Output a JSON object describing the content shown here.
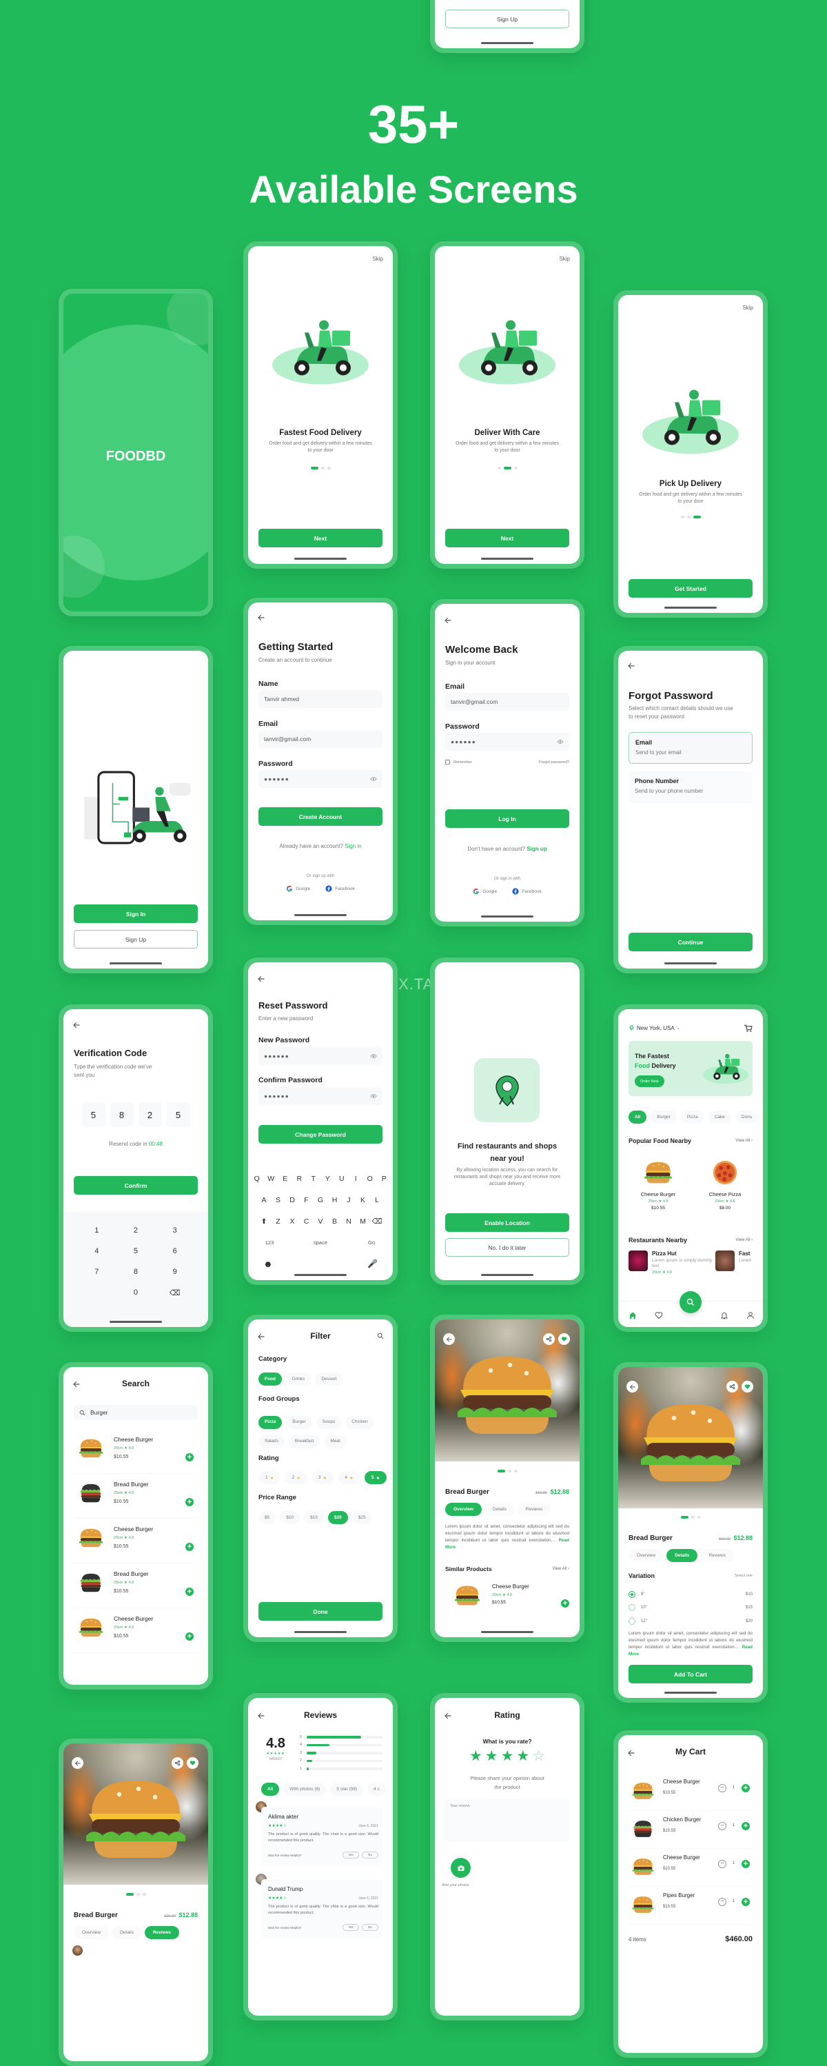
{
  "colors": {
    "background": "#21ba5b",
    "frame": "#4dc87b",
    "accent": "#22b85b",
    "light_accent": "#d4f2df",
    "star_rating": "#f4b740"
  },
  "hero": {
    "count": "35+",
    "title": "Available Screens"
  },
  "watermark": "早道大咖  IAMDX.TAOBAO.COM",
  "top_partial": {
    "sign_up": "Sign Up"
  },
  "splash": {
    "brand": "FOODBD"
  },
  "onboard1": {
    "skip": "Skip",
    "title": "Fastest Food Delivery",
    "desc": "Order food and get delivery within a few minutes to your door",
    "button": "Next",
    "active_page": 1,
    "pages": 3
  },
  "onboard2": {
    "skip": "Skip",
    "title": "Deliver With Care",
    "desc": "Order food and get delivery within a few minutes to your door",
    "button": "Next",
    "active_page": 2,
    "pages": 3
  },
  "onboard3": {
    "skip": "Skip",
    "title": "Pick Up Delivery",
    "desc": "Order food and get delivery within a few minutes to your door",
    "button": "Get Started",
    "active_page": 3,
    "pages": 3
  },
  "signin_landing": {
    "sign_in": "Sign In",
    "sign_up": "Sign Up"
  },
  "getting_started": {
    "title": "Getting Started",
    "subtitle": "Create an account to continue",
    "name_label": "Name",
    "name_value": "Tanvir ahmed",
    "email_label": "Email",
    "email_value": "tanvir@gmail.com",
    "password_label": "Password",
    "password_value": "●●●●●●",
    "button": "Create Account",
    "have_account": "Already have an account? ",
    "sign_in_link": "Sign in",
    "or": "Or sign up with",
    "google": "Google",
    "facebook": "Facebook"
  },
  "welcome_back": {
    "title": "Welcome Back",
    "subtitle": "Sign in your account",
    "email_label": "Email",
    "email_value": "tanvir@gmail.com",
    "password_label": "Password",
    "password_value": "●●●●●●",
    "remember": "Remember",
    "forgot": "Forgot password?",
    "remember_checked": false,
    "button": "Log In",
    "no_account": "Don't have an account? ",
    "sign_up_link": "Sign up",
    "or": "Or sign in with",
    "google": "Google",
    "facebook": "Facebook"
  },
  "forgot": {
    "title": "Forgot Password",
    "subtitle": "Select which contact details should we use to reset your password",
    "options": [
      {
        "title": "Email",
        "desc": "Send to your email",
        "selected": true
      },
      {
        "title": "Phone Number",
        "desc": "Send to your phone number",
        "selected": false
      }
    ],
    "button": "Continue"
  },
  "reset": {
    "title": "Reset Password",
    "subtitle": "Enter a new password",
    "new_label": "New Password",
    "new_value": "●●●●●●",
    "confirm_label": "Confirm Password",
    "confirm_value": "●●●●●●",
    "button": "Change Password",
    "keyboard": [
      [
        "Q",
        "W",
        "E",
        "R",
        "T",
        "Y",
        "U",
        "I",
        "O",
        "P"
      ],
      [
        "A",
        "S",
        "D",
        "F",
        "G",
        "H",
        "J",
        "K",
        "L"
      ],
      [
        "⬆",
        "Z",
        "X",
        "C",
        "V",
        "B",
        "N",
        "M",
        "⌫"
      ],
      [
        "123",
        "space",
        "Go"
      ]
    ]
  },
  "location": {
    "title": "Find restaurants and shops near you!",
    "desc": "By allowing location access, you can search for restaurants and shops near you and receive more accuate delivery.",
    "enable": "Enable Location",
    "later": "No. I do it later"
  },
  "verify": {
    "title": "Verification Code",
    "subtitle": "Type the verification code we've sent you",
    "code": [
      "5",
      "8",
      "2",
      "5"
    ],
    "resend": "Resend code in ",
    "timer": "00:48",
    "button": "Confirm",
    "keypad": [
      "1",
      "2",
      "3",
      "4",
      "5",
      "6",
      "7",
      "8",
      "9",
      "",
      "0",
      "⌫"
    ]
  },
  "home": {
    "location": "New York, USA",
    "banner_line1": "The Fastest",
    "banner_green": "Food",
    "banner_rest": " Delivery",
    "order_now": "Order Now",
    "chips": [
      "All",
      "Burger",
      "Pizza",
      "Cake",
      "Donu"
    ],
    "active_chip": 0,
    "popular": "Popular Food Nearby",
    "view_all": "View All",
    "foods": [
      {
        "name": "Cheese Burger",
        "dist": "25km",
        "rating": "4.8",
        "price": "$10.55"
      },
      {
        "name": "Cheese Pizza",
        "dist": "25km",
        "rating": "4.8",
        "price": "$8.00"
      }
    ],
    "restaurants_title": "Restaurants Nearby",
    "restaurants": [
      {
        "name": "Pizza Hut",
        "desc": "Lorem ipsum is simply dummy text",
        "dist": "25km",
        "rating": "4.8"
      },
      {
        "name": "Fast",
        "desc": "Lorem",
        "dist": "25km",
        "rating": ""
      }
    ]
  },
  "search": {
    "title": "Search",
    "query": "Burger",
    "results": [
      {
        "name": "Cheese Burger",
        "dist": "25km",
        "rating": "4.8",
        "price": "$10.55",
        "dark": false
      },
      {
        "name": "Bread Burger",
        "dist": "25km",
        "rating": "4.8",
        "price": "$10.55",
        "dark": true
      },
      {
        "name": "Cheese Burger",
        "dist": "25km",
        "rating": "4.8",
        "price": "$10.55",
        "dark": false
      },
      {
        "name": "Bread Burger",
        "dist": "25km",
        "rating": "4.8",
        "price": "$10.55",
        "dark": true
      },
      {
        "name": "Cheese Burger",
        "dist": "25km",
        "rating": "4.8",
        "price": "$10.55",
        "dark": false
      }
    ]
  },
  "filter": {
    "title": "Filter",
    "category_label": "Category",
    "categories": [
      "Food",
      "Drinks",
      "Dessert"
    ],
    "active_category": 0,
    "groups_label": "Food Groups",
    "groups": [
      "Pizza",
      "Burger",
      "Soups",
      "Chicken",
      "Salads",
      "Breakfast",
      "Meat"
    ],
    "active_group": 0,
    "rating_label": "Rating",
    "ratings": [
      "1",
      "2",
      "3",
      "4",
      "5"
    ],
    "active_rating": 4,
    "price_label": "Price Range",
    "prices": [
      "$5",
      "$10",
      "$15",
      "$20",
      "$25"
    ],
    "active_price": 3,
    "button": "Done"
  },
  "product": {
    "title": "Bread Burger",
    "old_price": "$15.00",
    "price": "$12.88",
    "tabs": [
      "Overview",
      "Details",
      "Reviews"
    ],
    "active_tab": 0,
    "desc": "Lorem ipsum dolor sit amet, consectetur adipiscing elit sed do eiusmod ipsum dolor  tempor incididunt ut labore do eiusmod tempor incididunt ut labor quis nostrud exercitation.... ",
    "read_more": "Read More",
    "similar": "Similar Products",
    "view_all": "View All",
    "similar_item": {
      "name": "Cheese Burger",
      "dist": "25km",
      "rating": "4.8",
      "price": "$10.55"
    }
  },
  "details": {
    "title": "Bread Burger",
    "old_price": "$15.00",
    "price": "$12.88",
    "tabs": [
      "Overview",
      "Details",
      "Reviews"
    ],
    "active_tab": 1,
    "variation": "Variation",
    "select": "Select one",
    "options": [
      {
        "size": "8\"",
        "price": "$10"
      },
      {
        "size": "10\"",
        "price": "$15"
      },
      {
        "size": "12\"",
        "price": "$20"
      }
    ],
    "selected": 0,
    "desc": "Lorem ipsum dolor sit amet, consectetur adipiscing elit sed do eiusmod ipsum dolor  tempor incididunt ut labore do eiusmod tempor incididunt ut labor quis nostrud exercitation.... ",
    "read_more": "Read More",
    "button": "Add To Cart"
  },
  "product_reviews": {
    "title": "Bread Burger",
    "old_price": "$15.00",
    "price": "$12.88",
    "tabs": [
      "Overview",
      "Details",
      "Reviews"
    ],
    "active_tab": 2
  },
  "reviews": {
    "title": "Reviews",
    "average": "4.8",
    "count": "643167",
    "bars": [
      {
        "star": "5",
        "fraction": 0.72
      },
      {
        "star": "4",
        "fraction": 0.3
      },
      {
        "star": "3",
        "fraction": 0.13
      },
      {
        "star": "2",
        "fraction": 0.07
      },
      {
        "star": "1",
        "fraction": 0.03
      }
    ],
    "chips": [
      "All",
      "With photos (6)",
      "5 star (99)",
      "4 s"
    ],
    "active_chip": 0,
    "items": [
      {
        "name": "Aklima akter",
        "stars": 4,
        "date": "June 6, 2021",
        "text": "The product is of good quality. The chair is a good size. Would recommended this product.",
        "helpful": "Was the review Helpful?",
        "yes": "Yes",
        "no": "No"
      },
      {
        "name": "Dunald Trump",
        "stars": 4,
        "date": "June 6, 2021",
        "text": "The product is of good quality. The chair is a good size. Would recommended this product.",
        "helpful": "Was the review Helpful?",
        "yes": "Yes",
        "no": "No"
      }
    ]
  },
  "rating": {
    "title": "Rating",
    "question": "What is you rate?",
    "stars": 4,
    "max_stars": 5,
    "prompt": "Please share your opinion about the product",
    "placeholder": "Your review",
    "add_photos": "Add your photos"
  },
  "cart": {
    "title": "My Cart",
    "items": [
      {
        "name": "Cheese Burger",
        "price": "$10.55",
        "qty": "1",
        "dark": false
      },
      {
        "name": "Chicken Burger",
        "price": "$10.55",
        "qty": "1",
        "dark": true
      },
      {
        "name": "Cheese Burger",
        "price": "$10.55",
        "qty": "1",
        "dark": false
      },
      {
        "name": "Pipes Burger",
        "price": "$10.55",
        "qty": "1",
        "dark": false
      }
    ],
    "count": "4 items",
    "total": "$460.00"
  }
}
